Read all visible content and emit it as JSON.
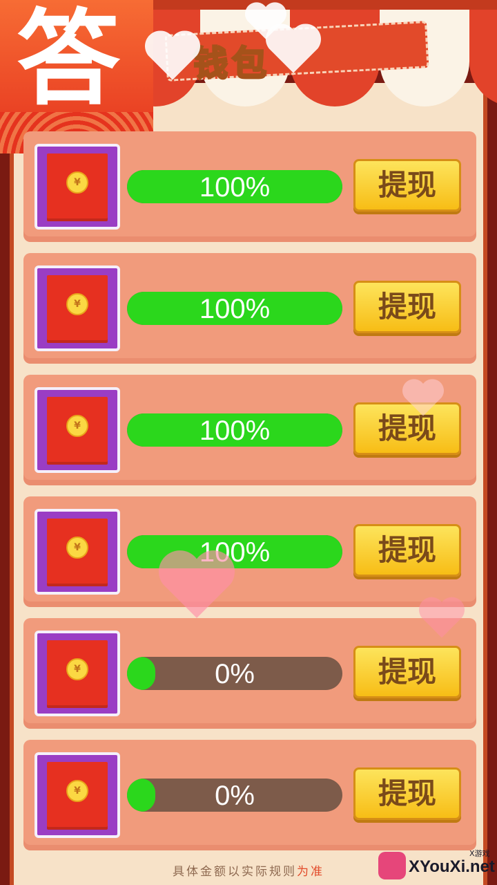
{
  "app_logo": {
    "char": "答"
  },
  "header": {
    "title": "钱包"
  },
  "currency_symbol": "¥",
  "rows": [
    {
      "progress_pct": 100,
      "progress_label": "100%",
      "button_label": "提现"
    },
    {
      "progress_pct": 100,
      "progress_label": "100%",
      "button_label": "提现"
    },
    {
      "progress_pct": 100,
      "progress_label": "100%",
      "button_label": "提现"
    },
    {
      "progress_pct": 100,
      "progress_label": "100%",
      "button_label": "提现"
    },
    {
      "progress_pct": 0,
      "progress_label": "0%",
      "button_label": "提现"
    },
    {
      "progress_pct": 0,
      "progress_label": "0%",
      "button_label": "提现"
    }
  ],
  "footer": {
    "note_main": "具体金额以实际规则",
    "note_accent": "为准"
  },
  "watermark": {
    "text": "XYouXi.net",
    "small": "X游戏"
  },
  "colors": {
    "progress_green": "#2bd71c",
    "button_gold": "#f7bd16",
    "envelope_red": "#e63020",
    "frame_purple": "#9a3dc4"
  }
}
